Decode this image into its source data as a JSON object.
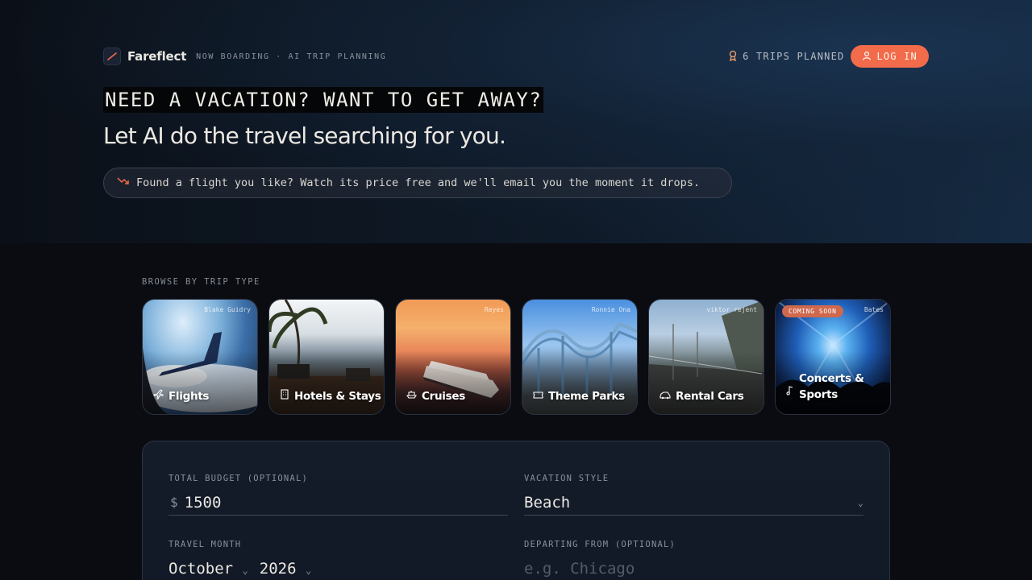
{
  "brand": {
    "name": "Fareflect",
    "tagline": "NOW BOARDING · AI TRIP PLANNING"
  },
  "nav": {
    "trips_planned": "6 TRIPS PLANNED",
    "login_label": "LOG IN"
  },
  "hero": {
    "headline": "NEED A VACATION? WANT TO GET AWAY?",
    "subhead": "Let AI do the travel searching for you.",
    "notice": "Found a flight you like? Watch its price free and we'll email you the moment it drops."
  },
  "browse": {
    "label": "BROWSE BY TRIP TYPE",
    "cards": [
      {
        "label": "Flights",
        "credit": "Blake Guidry",
        "icon": "plane-icon"
      },
      {
        "label": "Hotels & Stays",
        "credit": "",
        "icon": "building-icon"
      },
      {
        "label": "Cruises",
        "credit": "Reyes",
        "icon": "ship-icon"
      },
      {
        "label": "Theme Parks",
        "credit": "Ronnie Ona",
        "icon": "ticket-icon"
      },
      {
        "label": "Rental Cars",
        "credit": "viktor rejent",
        "icon": "car-icon"
      },
      {
        "label_line1": "Concerts &",
        "label_line2": "Sports",
        "credit": "Bates",
        "badge": "COMING SOON",
        "icon": "music-note-icon"
      }
    ]
  },
  "form": {
    "budget": {
      "label": "TOTAL BUDGET (OPTIONAL)",
      "currency": "$",
      "value": "1500"
    },
    "style": {
      "label": "VACATION STYLE",
      "value": "Beach"
    },
    "month": {
      "label": "TRAVEL MONTH",
      "month": "October",
      "year": "2026"
    },
    "departing": {
      "label": "DEPARTING FROM (OPTIONAL)",
      "placeholder": "e.g. Chicago"
    }
  },
  "colors": {
    "accent": "#f26b4a",
    "background": "#0a0c11"
  }
}
